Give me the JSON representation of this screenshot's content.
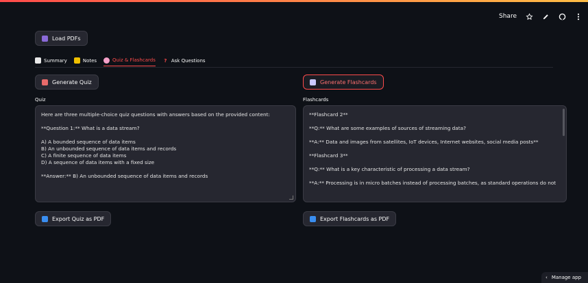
{
  "topbar": {
    "share_label": "Share"
  },
  "load_button": {
    "label": "Load PDFs",
    "icon": "folder-icon"
  },
  "tabs": [
    {
      "label": "Summary",
      "icon": "page-icon",
      "active": false
    },
    {
      "label": "Notes",
      "icon": "notebook-icon",
      "active": false
    },
    {
      "label": "Quiz & Flashcards",
      "icon": "brain-icon",
      "active": true
    },
    {
      "label": "Ask Questions",
      "icon": "question-icon",
      "active": false
    }
  ],
  "quiz": {
    "generate_label": "Generate Quiz",
    "field_label": "Quiz",
    "lines": [
      "Here are three multiple-choice quiz questions with answers based on the provided content:",
      "",
      "**Question 1:** What is a data stream?",
      "",
      "A) A bounded sequence of data items",
      "B) An unbounded sequence of data items and records",
      "C) A finite sequence of data items",
      "D) A sequence of data items with a fixed size",
      "",
      "**Answer:** B) An unbounded sequence of data items and records"
    ],
    "export_label": "Export Quiz as PDF"
  },
  "flashcards": {
    "generate_label": "Generate Flashcards",
    "field_label": "Flashcards",
    "lines": [
      "**Flashcard 2**",
      "",
      "**Q:** What are some examples of sources of streaming data?",
      "",
      "**A:** Data and images from satellites, IoT devices, Internet websites, social media posts**",
      "",
      "**Flashcard 3**",
      "",
      "**Q:** What is a key characteristic of processing a data stream?",
      "",
      "**A:** Processing is in micro batches instead of processing batches, as standard operations do not"
    ],
    "export_label": "Export Flashcards as PDF"
  },
  "manage_app": {
    "label": "Manage app"
  },
  "colors": {
    "accent": "#ff4b4b",
    "background": "#0e1117",
    "surface": "#262730"
  }
}
